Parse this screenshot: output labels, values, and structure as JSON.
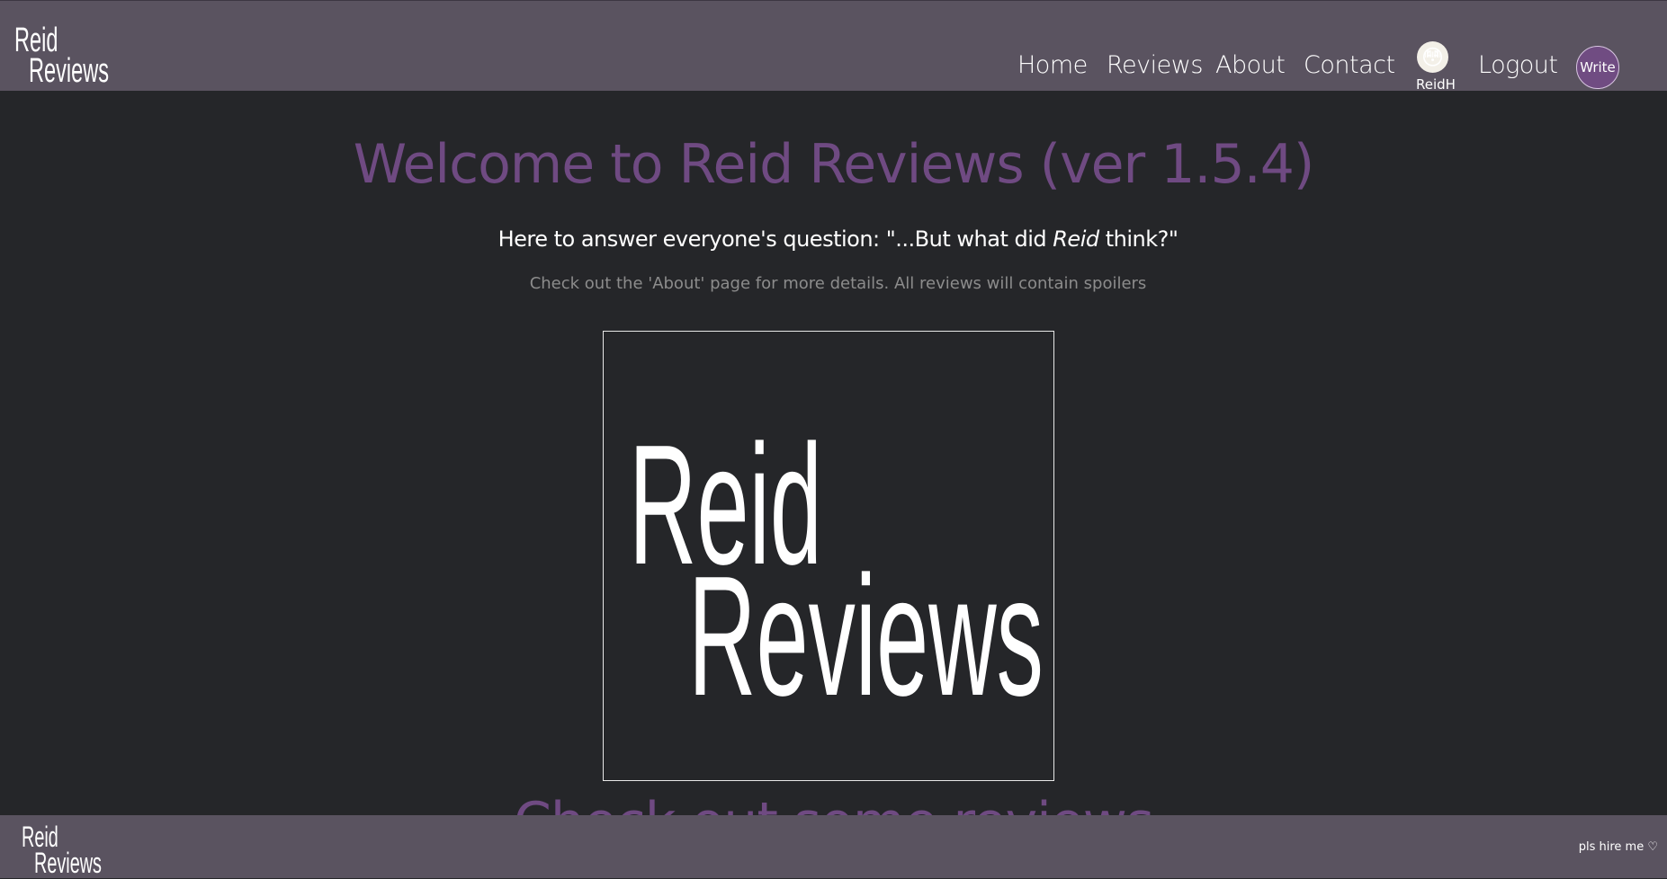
{
  "header": {
    "logo_line1": "Reid",
    "logo_line2": "Reviews",
    "nav": {
      "home": "Home",
      "reviews": "Reviews",
      "about": "About",
      "contact": "Contact",
      "logout": "Logout"
    },
    "user": {
      "name": "ReidH",
      "avatar_emoji": "😳"
    },
    "write_label": "Write"
  },
  "main": {
    "title": "Welcome to Reid Reviews (ver 1.5.4)",
    "subtitle_pre": "Here to answer everyone's question: \"...But what did ",
    "subtitle_em": "Reid",
    "subtitle_post": " think?\"",
    "note": "Check out the 'About' page for more details. All reviews will contain spoilers",
    "hero_logo_line1": "Reid",
    "hero_logo_line2": "Reviews",
    "section_heading": "Check out some reviews"
  },
  "footer": {
    "logo_line1": "Reid",
    "logo_line2": "Reviews",
    "hire_text": "pls hire me ♡"
  },
  "colors": {
    "header_bg": "#5a5360",
    "page_bg": "#252629",
    "accent_purple": "#6f4a82"
  }
}
